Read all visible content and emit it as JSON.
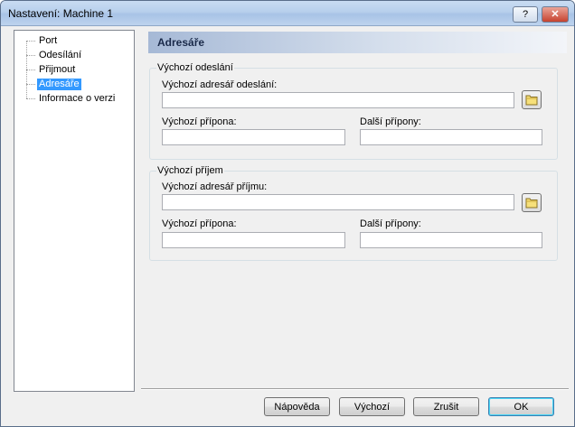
{
  "window": {
    "title": "Nastavení: Machine 1",
    "help_label": "?",
    "close_label": "✕"
  },
  "tree": {
    "items": [
      {
        "label": "Port",
        "selected": false
      },
      {
        "label": "Odesílání",
        "selected": false
      },
      {
        "label": "Přijmout",
        "selected": false
      },
      {
        "label": "Adresáře",
        "selected": true
      },
      {
        "label": "Informace o verzi",
        "selected": false
      }
    ]
  },
  "panel": {
    "title": "Adresáře",
    "send_group": {
      "label": "Výchozí odeslání",
      "dir_label": "Výchozí adresář odeslání:",
      "dir_value": "",
      "ext_label": "Výchozí přípona:",
      "ext_value": "",
      "other_ext_label": "Další přípony:",
      "other_ext_value": ""
    },
    "receive_group": {
      "label": "Výchozí příjem",
      "dir_label": "Výchozí adresář příjmu:",
      "dir_value": "",
      "ext_label": "Výchozí přípona:",
      "ext_value": "",
      "other_ext_label": "Další přípony:",
      "other_ext_value": ""
    }
  },
  "buttons": {
    "help": "Nápověda",
    "default": "Výchozí",
    "cancel": "Zrušit",
    "ok": "OK"
  },
  "icons": {
    "folder": "folder-icon"
  }
}
